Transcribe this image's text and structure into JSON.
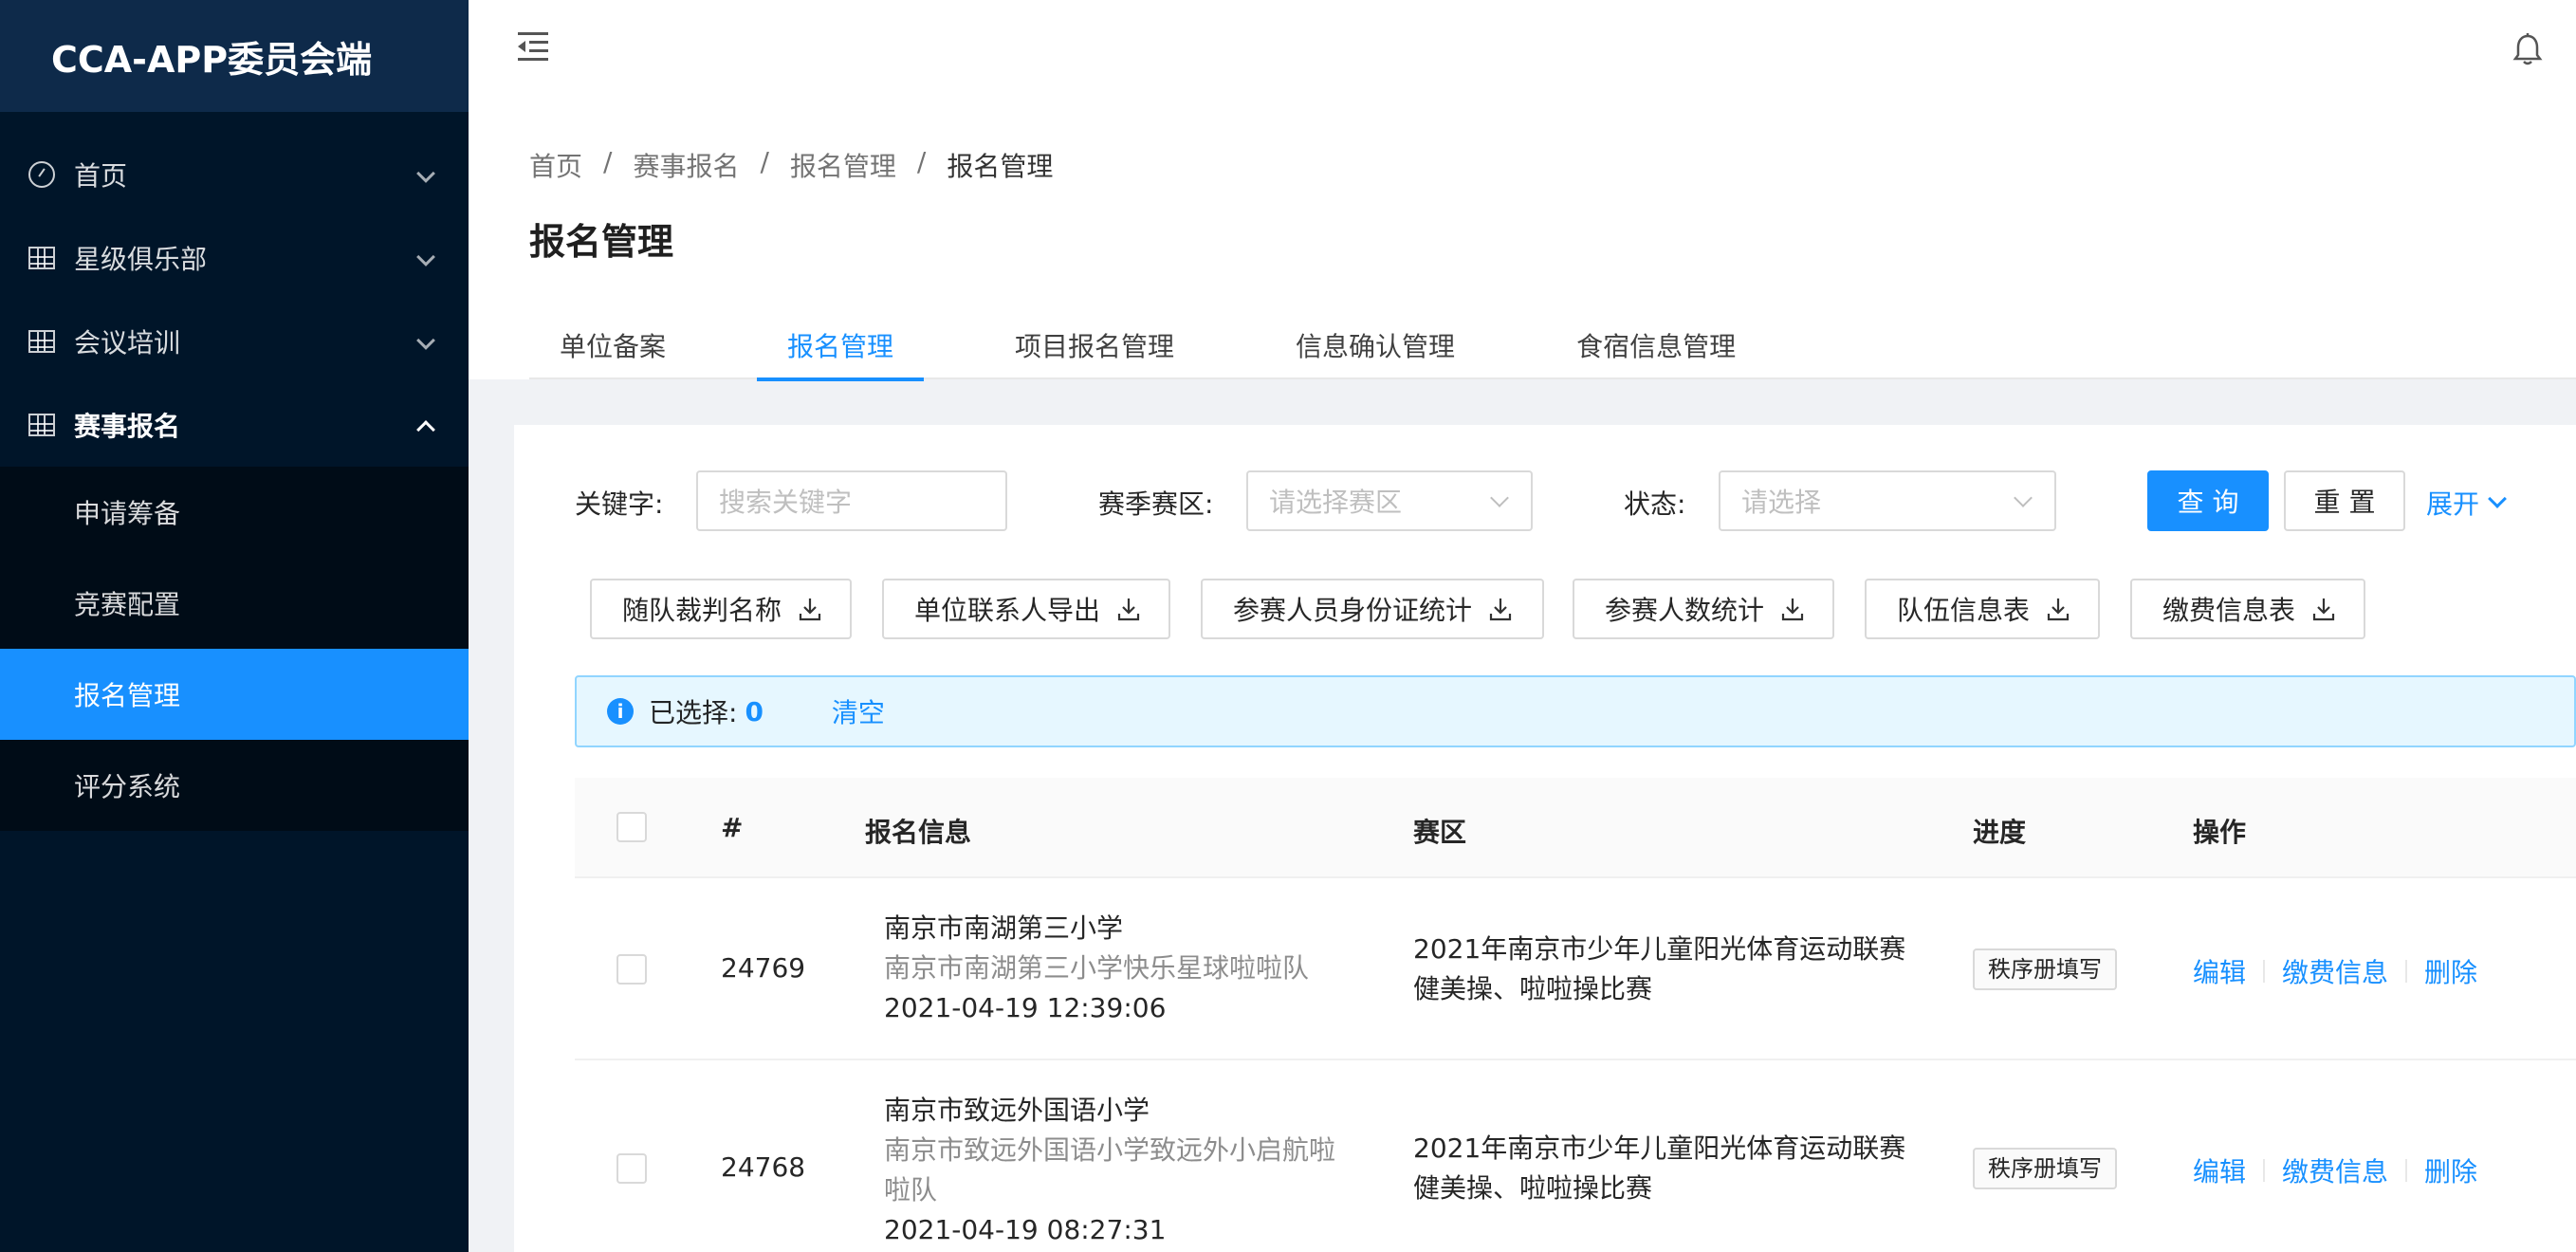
{
  "app": {
    "title": "CCA-APP委员会端"
  },
  "sidebar": {
    "items": [
      {
        "label": "首页",
        "icon": "dashboard-icon"
      },
      {
        "label": "星级俱乐部",
        "icon": "table-icon"
      },
      {
        "label": "会议培训",
        "icon": "table-icon"
      },
      {
        "label": "赛事报名",
        "icon": "table-icon",
        "open": true
      }
    ],
    "submenu": [
      {
        "label": "申请筹备"
      },
      {
        "label": "竞赛配置"
      },
      {
        "label": "报名管理",
        "active": true
      },
      {
        "label": "评分系统"
      }
    ]
  },
  "breadcrumb": [
    "首页",
    "赛事报名",
    "报名管理",
    "报名管理"
  ],
  "breadcrumb_sep": "/",
  "page": {
    "title": "报名管理"
  },
  "tabs": [
    {
      "label": "单位备案"
    },
    {
      "label": "报名管理",
      "active": true
    },
    {
      "label": "项目报名管理"
    },
    {
      "label": "信息确认管理"
    },
    {
      "label": "食宿信息管理"
    }
  ],
  "filters": {
    "keyword_label": "关键字:",
    "keyword_placeholder": "搜索关键字",
    "zone_label": "赛季赛区:",
    "zone_placeholder": "请选择赛区",
    "status_label": "状态:",
    "status_placeholder": "请选择",
    "query_button": "查 询",
    "reset_button": "重 置",
    "expand_link": "展开"
  },
  "exports": [
    {
      "label": "随队裁判名称"
    },
    {
      "label": "单位联系人导出"
    },
    {
      "label": "参赛人员身份证统计"
    },
    {
      "label": "参赛人数统计"
    },
    {
      "label": "队伍信息表"
    },
    {
      "label": "缴费信息表"
    }
  ],
  "alert": {
    "selected_label": "已选择:",
    "selected_count": "0",
    "clear_label": "清空"
  },
  "table": {
    "columns": [
      "#",
      "报名信息",
      "赛区",
      "进度",
      "操作"
    ],
    "rows": [
      {
        "id": "24769",
        "org": "南京市南湖第三小学",
        "team": "南京市南湖第三小学快乐星球啦啦队",
        "time": "2021-04-19 12:39:06",
        "zone_line1": "2021年南京市少年儿童阳光体育运动联赛",
        "zone_line2": "健美操、啦啦操比赛",
        "progress": "秩序册填写",
        "ops": [
          "编辑",
          "缴费信息",
          "删除"
        ]
      },
      {
        "id": "24768",
        "org": "南京市致远外国语小学",
        "team_line1": "南京市致远外国语小学致远外小启航啦",
        "team_line2": "啦队",
        "time": "2021-04-19 08:27:31",
        "zone_line1": "2021年南京市少年儿童阳光体育运动联赛",
        "zone_line2": "健美操、啦啦操比赛",
        "progress": "秩序册填写",
        "ops": [
          "编辑",
          "缴费信息",
          "删除"
        ]
      }
    ]
  }
}
